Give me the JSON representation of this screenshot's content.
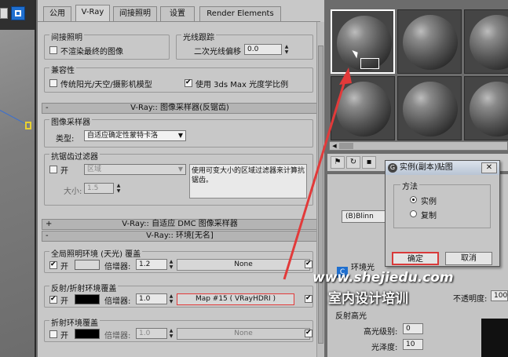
{
  "render_tabs": [
    "公用",
    "V-Ray",
    "间接照明",
    "设置",
    "Render Elements"
  ],
  "gi_section": {
    "title": "间接照明",
    "no_render_final": "不渲染最终的图像"
  },
  "raytrace": {
    "title": "光线跟踪",
    "secondary_bias_label": "二次光线偏移",
    "secondary_bias": "0.0"
  },
  "compat": {
    "title": "兼容性",
    "legacy_label": "传统阳光/天空/摄影机模型",
    "photometric_label": "使用 3ds Max 光度学比例"
  },
  "image_sampler_bar": "V-Ray:: 图像采样器(反锯齿)",
  "image_sampler": {
    "title": "图像采样器",
    "type_label": "类型:",
    "type_value": "自适应确定性蒙特卡洛"
  },
  "aa_filter": {
    "title": "抗锯齿过滤器",
    "on_label": "开",
    "filter": "区域",
    "size_label": "大小:",
    "size": "1.5",
    "desc": "使用可变大小的区域过滤器来计算抗锯齿。"
  },
  "dmc_bar": "V-Ray:: 自适应 DMC 图像采样器",
  "env_bar": "V-Ray:: 环境[无名]",
  "gi_env": {
    "title": "全局照明环境 (天光) 覆盖",
    "on_label": "开",
    "mult_label": "倍增器:",
    "mult": "1.2",
    "map": "None"
  },
  "refl_env": {
    "title": "反射/折射环境覆盖",
    "on_label": "开",
    "mult_label": "倍增器:",
    "mult": "1.0",
    "map": "Map #15  ( VRayHDRI )"
  },
  "refr_env": {
    "title": "折射环境覆盖",
    "on_label": "开",
    "mult_label": "倍增器:",
    "mult": "1.0",
    "map": "None"
  },
  "material_editor": {
    "shader": "(B)Blinn",
    "label_env": "环境光",
    "blinn_hl": "反射高光",
    "spec_level_label": "高光级别:",
    "spec_level": "0",
    "gloss_label": "光泽度:",
    "gloss": "10",
    "opacity_label": "不透明度:",
    "opacity": "100"
  },
  "dialog": {
    "title": "实例(副本)贴图",
    "group": "方法",
    "opt_instance": "实例",
    "opt_copy": "复制",
    "ok": "确定",
    "cancel": "取消"
  },
  "watermark": {
    "url": "www.shejiedu.com",
    "name": "室内设计培训"
  },
  "colors": {
    "highlight_red": "#e23a3a"
  }
}
